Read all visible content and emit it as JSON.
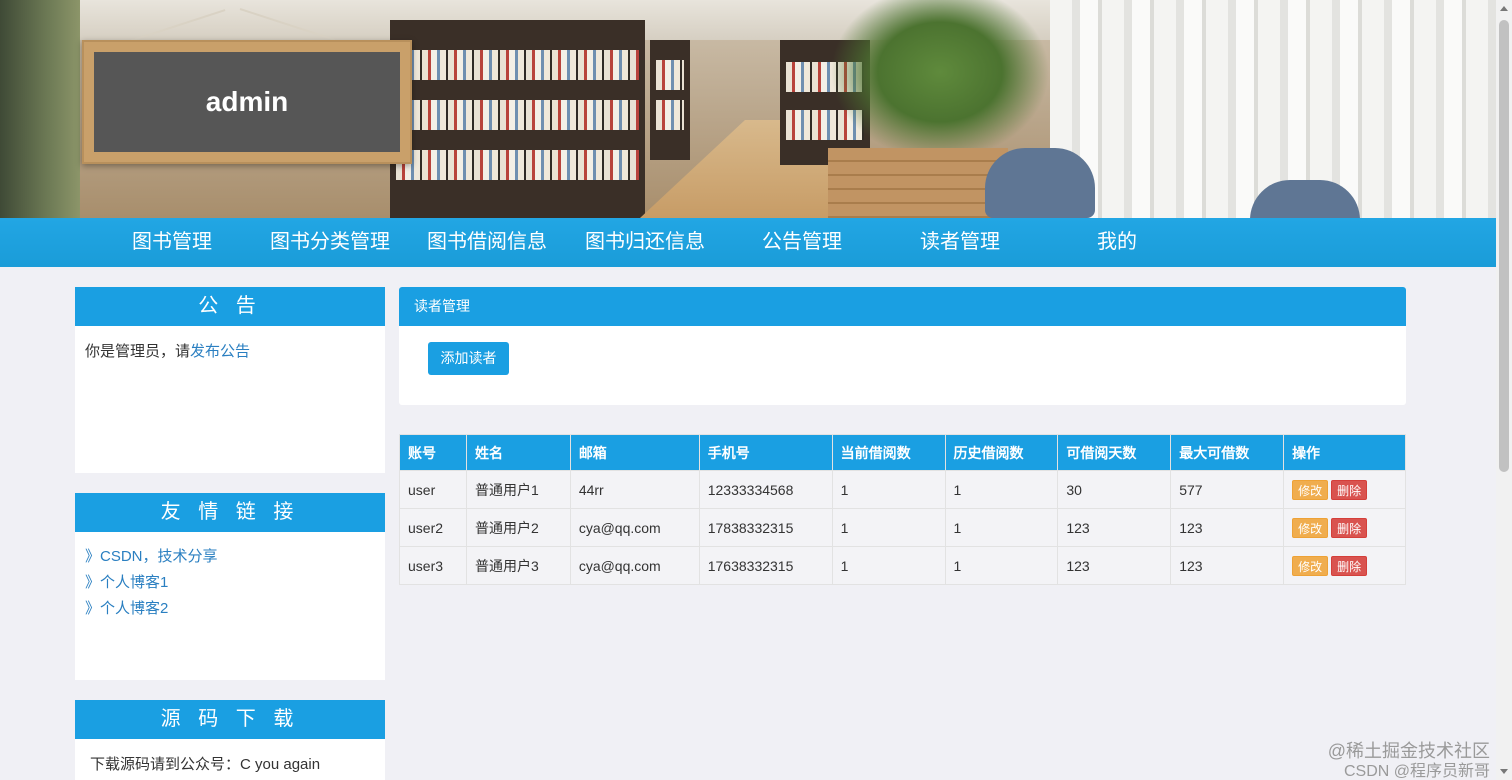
{
  "banner": {
    "sign_text": "admin"
  },
  "nav": {
    "items": [
      {
        "label": "图书管理"
      },
      {
        "label": "图书分类管理"
      },
      {
        "label": "图书借阅信息"
      },
      {
        "label": "图书归还信息"
      },
      {
        "label": "公告管理"
      },
      {
        "label": "读者管理"
      },
      {
        "label": "我的"
      }
    ]
  },
  "sidebar": {
    "notice": {
      "title": "公 告",
      "text_prefix": "你是管理员，请",
      "link": "发布公告"
    },
    "friends": {
      "title": "友 情 链 接",
      "links": [
        "》CSDN，技术分享",
        "》个人博客1",
        "》个人博客2"
      ]
    },
    "source": {
      "title": "源 码 下 载",
      "text": "下载源码请到公众号：C you again"
    }
  },
  "main": {
    "title": "读者管理",
    "add_button": "添加读者",
    "table": {
      "headers": [
        "账号",
        "姓名",
        "邮箱",
        "手机号",
        "当前借阅数",
        "历史借阅数",
        "可借阅天数",
        "最大可借数",
        "操作"
      ],
      "rows": [
        [
          "user",
          "普通用户1",
          "44rr",
          "12333334568",
          "1",
          "1",
          "30",
          "577"
        ],
        [
          "user2",
          "普通用户2",
          "cya@qq.com",
          "17838332315",
          "1",
          "1",
          "123",
          "123"
        ],
        [
          "user3",
          "普通用户3",
          "cya@qq.com",
          "17638332315",
          "1",
          "1",
          "123",
          "123"
        ]
      ],
      "edit_label": "修改",
      "delete_label": "删除"
    }
  },
  "watermark": {
    "line1": "@稀土掘金技术社区",
    "line2": "CSDN @程序员新哥"
  }
}
